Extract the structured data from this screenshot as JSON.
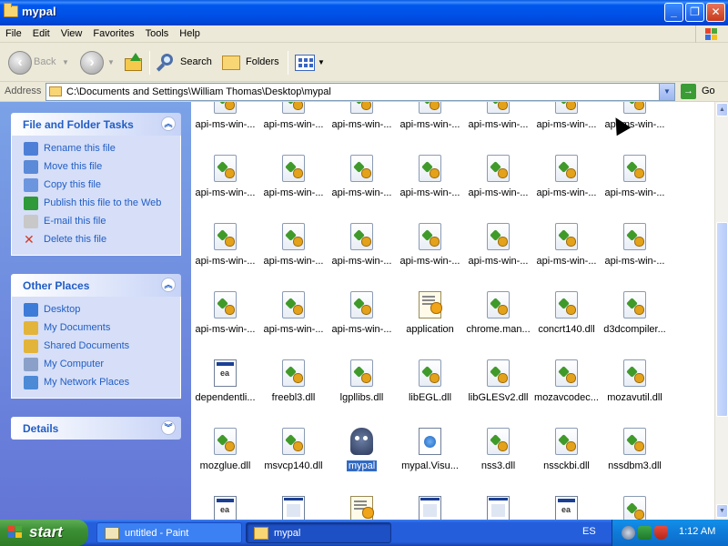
{
  "window": {
    "title": "mypal",
    "buttons": {
      "minimize": "_",
      "maximize": "❐",
      "close": "✕"
    }
  },
  "menu": [
    "File",
    "Edit",
    "View",
    "Favorites",
    "Tools",
    "Help"
  ],
  "toolbar": {
    "back_label": "Back",
    "search_label": "Search",
    "folders_label": "Folders"
  },
  "address": {
    "label": "Address",
    "value": "C:\\Documents and Settings\\William Thomas\\Desktop\\mypal",
    "go_label": "Go"
  },
  "tasks_panel": {
    "title": "File and Folder Tasks",
    "items": [
      {
        "label": "Rename this file",
        "icon": "rename-icon"
      },
      {
        "label": "Move this file",
        "icon": "move-icon"
      },
      {
        "label": "Copy this file",
        "icon": "copy-icon"
      },
      {
        "label": "Publish this file to the Web",
        "icon": "publish-web-icon"
      },
      {
        "label": "E-mail this file",
        "icon": "email-icon"
      },
      {
        "label": "Delete this file",
        "icon": "delete-icon"
      }
    ]
  },
  "places_panel": {
    "title": "Other Places",
    "items": [
      {
        "label": "Desktop",
        "icon": "desktop-icon"
      },
      {
        "label": "My Documents",
        "icon": "my-documents-icon"
      },
      {
        "label": "Shared Documents",
        "icon": "shared-documents-icon"
      },
      {
        "label": "My Computer",
        "icon": "my-computer-icon"
      },
      {
        "label": "My Network Places",
        "icon": "network-places-icon"
      }
    ]
  },
  "details_panel": {
    "title": "Details"
  },
  "files": [
    {
      "label": "api-ms-win-...",
      "type": "dll"
    },
    {
      "label": "api-ms-win-...",
      "type": "dll"
    },
    {
      "label": "api-ms-win-...",
      "type": "dll"
    },
    {
      "label": "api-ms-win-...",
      "type": "dll"
    },
    {
      "label": "api-ms-win-...",
      "type": "dll"
    },
    {
      "label": "api-ms-win-...",
      "type": "dll"
    },
    {
      "label": "api-ms-win-...",
      "type": "dll"
    },
    {
      "label": "api-ms-win-...",
      "type": "dll"
    },
    {
      "label": "api-ms-win-...",
      "type": "dll"
    },
    {
      "label": "api-ms-win-...",
      "type": "dll"
    },
    {
      "label": "api-ms-win-...",
      "type": "dll"
    },
    {
      "label": "api-ms-win-...",
      "type": "dll"
    },
    {
      "label": "api-ms-win-...",
      "type": "dll"
    },
    {
      "label": "api-ms-win-...",
      "type": "dll"
    },
    {
      "label": "api-ms-win-...",
      "type": "dll"
    },
    {
      "label": "api-ms-win-...",
      "type": "dll"
    },
    {
      "label": "api-ms-win-...",
      "type": "dll"
    },
    {
      "label": "api-ms-win-...",
      "type": "dll"
    },
    {
      "label": "api-ms-win-...",
      "type": "dll"
    },
    {
      "label": "api-ms-win-...",
      "type": "dll"
    },
    {
      "label": "api-ms-win-...",
      "type": "dll"
    },
    {
      "label": "api-ms-win-...",
      "type": "dll"
    },
    {
      "label": "api-ms-win-...",
      "type": "dll"
    },
    {
      "label": "api-ms-win-...",
      "type": "dll"
    },
    {
      "label": "application",
      "type": "cfg"
    },
    {
      "label": "chrome.man...",
      "type": "dll"
    },
    {
      "label": "concrt140.dll",
      "type": "dll"
    },
    {
      "label": "d3dcompiler...",
      "type": "dll"
    },
    {
      "label": "dependentli...",
      "type": "mani"
    },
    {
      "label": "freebl3.dll",
      "type": "dll"
    },
    {
      "label": "lgpllibs.dll",
      "type": "dll"
    },
    {
      "label": "libEGL.dll",
      "type": "dll"
    },
    {
      "label": "libGLESv2.dll",
      "type": "dll"
    },
    {
      "label": "mozavcodec...",
      "type": "dll"
    },
    {
      "label": "mozavutil.dll",
      "type": "dll"
    },
    {
      "label": "mozglue.dll",
      "type": "dll"
    },
    {
      "label": "msvcp140.dll",
      "type": "dll"
    },
    {
      "label": "mypal",
      "type": "pal",
      "selected": true
    },
    {
      "label": "mypal.Visu...",
      "type": "vis"
    },
    {
      "label": "nss3.dll",
      "type": "dll"
    },
    {
      "label": "nssckbi.dll",
      "type": "dll"
    },
    {
      "label": "nssdbm3.dll",
      "type": "dll"
    },
    {
      "label": "",
      "type": "mani"
    },
    {
      "label": "",
      "type": "app"
    },
    {
      "label": "",
      "type": "cfg"
    },
    {
      "label": "",
      "type": "app"
    },
    {
      "label": "",
      "type": "app"
    },
    {
      "label": "",
      "type": "mani"
    },
    {
      "label": "",
      "type": "dll"
    }
  ],
  "taskbar": {
    "start_label": "start",
    "tasks": [
      {
        "label": "untitled - Paint",
        "icon": "paint-icon"
      },
      {
        "label": "mypal",
        "icon": "folder-icon"
      }
    ],
    "language": "ES",
    "clock": "1:12 AM"
  }
}
